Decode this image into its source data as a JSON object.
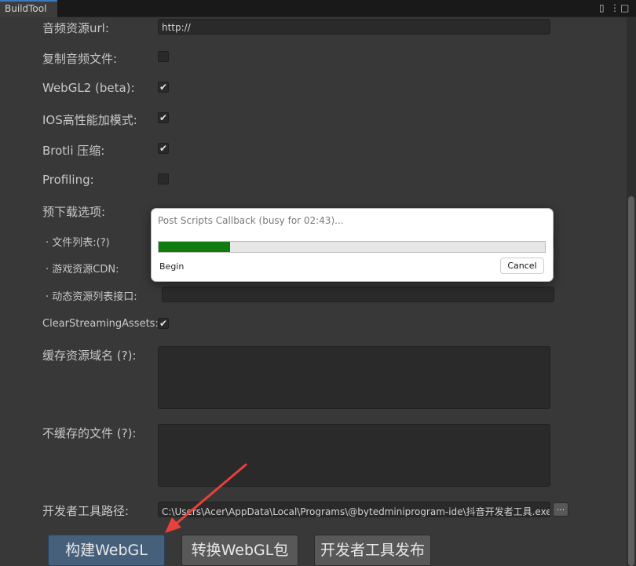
{
  "window": {
    "tab_title": "BuildTool",
    "lock_glyph": "▯",
    "menu_glyph": "⋮",
    "maximize_glyph": "□",
    "close_glyph": "✕"
  },
  "form": {
    "audio_url_label": "音频资源url:",
    "audio_url_value": "http://",
    "copy_audio_label": "复制音频文件:",
    "webgl2_label": "WebGL2 (beta):",
    "ios_perf_label": "IOS高性能加模式:",
    "brotli_label": "Brotli 压缩:",
    "profiling_label": "Profiling:",
    "preload_label": "预下载选项:",
    "file_list_label": "· 文件列表:(?)",
    "game_cdn_label": "· 游戏资源CDN:",
    "dynamic_list_label": "· 动态资源列表接口:",
    "clear_streaming_label": "ClearStreamingAssets:",
    "cache_domain_label": "缓存资源域名 (?):",
    "no_cache_label": "不缓存的文件 (?):",
    "devtool_path_label": "开发者工具路径:",
    "devtool_path_value": "C:\\Users\\Acer\\AppData\\Local\\Programs\\@bytedminiprogram-ide\\抖音开发者工具.exe",
    "browse_label": "...",
    "check_glyph": "✔"
  },
  "checkboxes": {
    "copy_audio": false,
    "webgl2": true,
    "ios_perf": true,
    "brotli": true,
    "profiling": false,
    "clear_streaming": true
  },
  "buttons": {
    "build_webgl": "构建WebGL",
    "convert_webgl": "转换WebGL包",
    "devtool_publish": "开发者工具发布"
  },
  "progress_dialog": {
    "title": "Post Scripts Callback (busy for 02:43)...",
    "status": "Begin",
    "cancel_label": "Cancel",
    "progress": 0.185
  },
  "colors": {
    "accent": "#3a79bb",
    "progress": "#107c10",
    "active_button": "#46607c",
    "arrow": "#e8403a"
  }
}
